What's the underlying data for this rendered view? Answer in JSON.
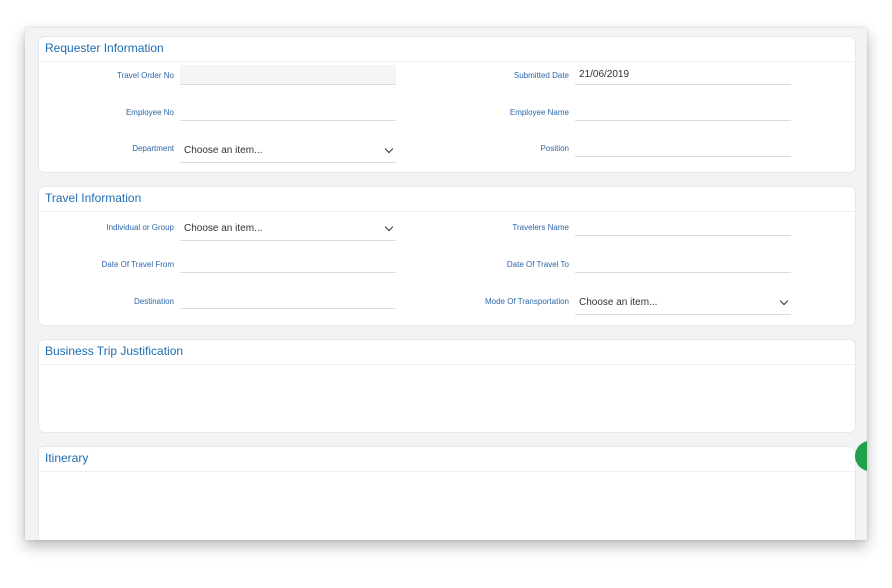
{
  "requester": {
    "title": "Requester Information",
    "travel_order_no": {
      "label": "Travel Order No",
      "value": ""
    },
    "submitted_date": {
      "label": "Submitted Date",
      "value": "21/06/2019"
    },
    "employee_no": {
      "label": "Employee No",
      "value": ""
    },
    "employee_name": {
      "label": "Employee Name",
      "value": ""
    },
    "department": {
      "label": "Department",
      "value": "Choose an item..."
    },
    "position": {
      "label": "Position",
      "value": ""
    }
  },
  "travel": {
    "title": "Travel Information",
    "individual_or_group": {
      "label": "Individual or Group",
      "value": "Choose an item..."
    },
    "travelers_name": {
      "label": "Travelers Name",
      "value": ""
    },
    "date_from": {
      "label": "Date Of Travel From",
      "value": ""
    },
    "date_to": {
      "label": "Date Of Travel To",
      "value": ""
    },
    "destination": {
      "label": "Destination",
      "value": ""
    },
    "mode_of_transportation": {
      "label": "Mode Of Transportation",
      "value": "Choose an item..."
    }
  },
  "justification": {
    "title": "Business Trip Justification"
  },
  "itinerary": {
    "title": "Itinerary"
  },
  "colors": {
    "accent": "#1f6db0",
    "label": "#2e67a8",
    "fab": "#20a24a"
  }
}
